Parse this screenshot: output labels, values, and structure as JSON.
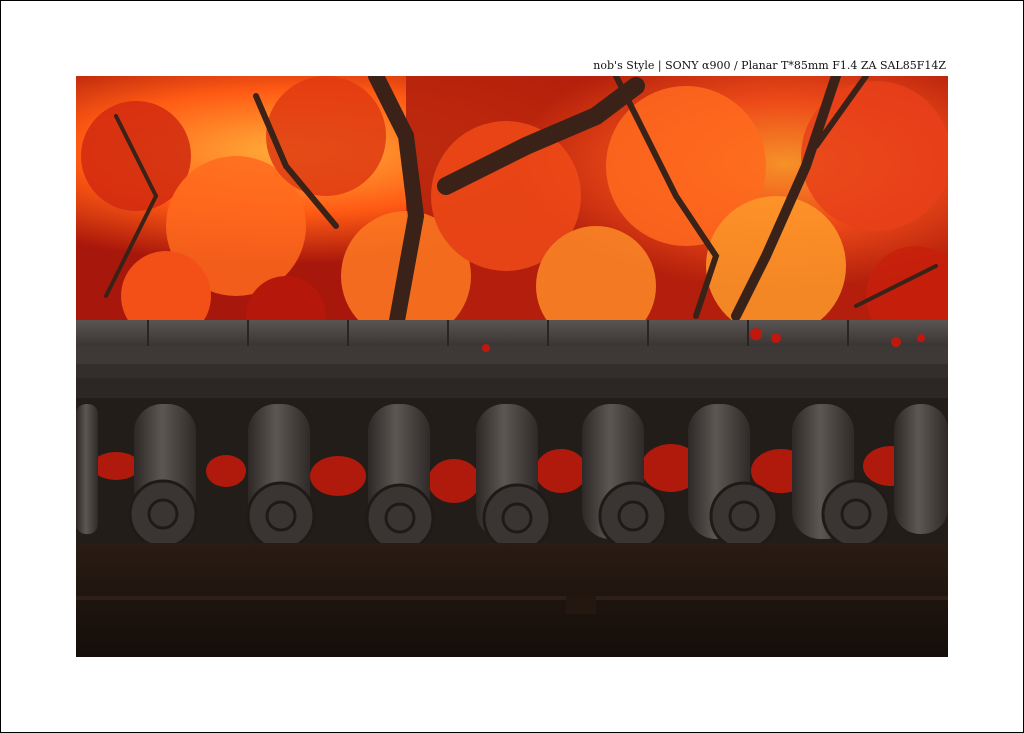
{
  "caption": "nob's Style  |  SONY α900  /  Planar T*85mm F1.4 ZA  SAL85F14Z",
  "photo": {
    "subject": "autumn-maple-over-temple-roof-tiles",
    "colors": {
      "foliage_bright": "#ff6a1e",
      "foliage_deep": "#b0180a",
      "foliage_gold": "#ff9a2a",
      "branch": "#3a2218",
      "roof": "#4b4745",
      "roof_dark": "#2a2523",
      "wall": "#1c130e"
    }
  }
}
